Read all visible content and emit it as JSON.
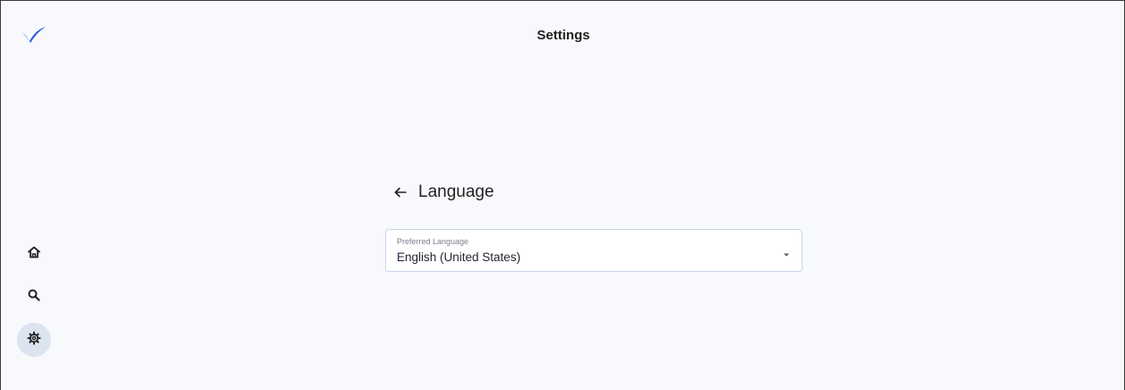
{
  "header": {
    "title": "Settings",
    "logo_icon": "checkmark-logo",
    "brand_color": "#2f5be0"
  },
  "sidebar": {
    "items": [
      {
        "icon": "home-icon",
        "active": false
      },
      {
        "icon": "search-icon",
        "active": false
      },
      {
        "icon": "gear-icon",
        "active": true
      }
    ]
  },
  "section": {
    "title": "Language",
    "back_icon": "arrow-left-icon"
  },
  "language_select": {
    "label": "Preferred Language",
    "value": "English (United States)",
    "caret_icon": "caret-down-icon"
  }
}
